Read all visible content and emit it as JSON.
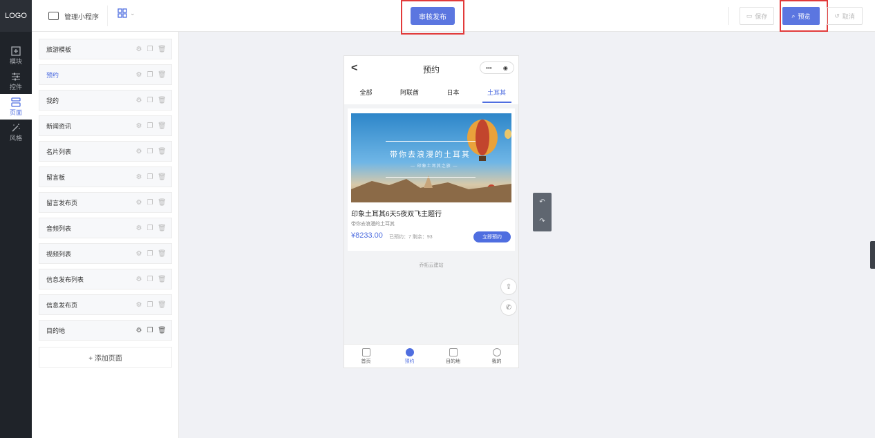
{
  "rail": {
    "logo": "LOGO",
    "items": [
      {
        "label": "模块",
        "icon": "plus-square-icon"
      },
      {
        "label": "控件",
        "icon": "sliders-icon"
      },
      {
        "label": "页面",
        "icon": "pages-icon"
      },
      {
        "label": "风格",
        "icon": "magic-wand-icon"
      }
    ]
  },
  "topbar": {
    "app_name": "管理小程序",
    "audit_label": "审核发布",
    "save_label": "保存",
    "preview_label": "预览",
    "cancel_label": "取消"
  },
  "pages": {
    "items": [
      "旅游模板",
      "预约",
      "我的",
      "新闻资讯",
      "名片列表",
      "留言板",
      "留言发布页",
      "音频列表",
      "视频列表",
      "信息发布列表",
      "信息发布页",
      "目的地"
    ],
    "active_index": 1,
    "add_label": "+ 添加页面"
  },
  "phone": {
    "title": "预约",
    "capsule_dots": "•••",
    "tabs": [
      "全部",
      "阿联酋",
      "日本",
      "土耳其"
    ],
    "active_tab": 3,
    "banner_title": "带你去浪漫的土耳其",
    "banner_sub": "— 印象土耳其之旅 —",
    "card_title": "印象土耳其6天5夜双飞主题行",
    "card_sub": "带你去浪漫的土耳其",
    "price": "¥8233.00",
    "price_meta": "已预约：7  剩余：93",
    "book_label": "立即预约",
    "footer": "乔拓云建站",
    "nav": [
      "首页",
      "预约",
      "目的地",
      "我的"
    ],
    "nav_active": 1
  },
  "colors": {
    "accent": "#4f6ee0",
    "highlight": "#e23a3a",
    "rail_bg": "#1f2329"
  }
}
